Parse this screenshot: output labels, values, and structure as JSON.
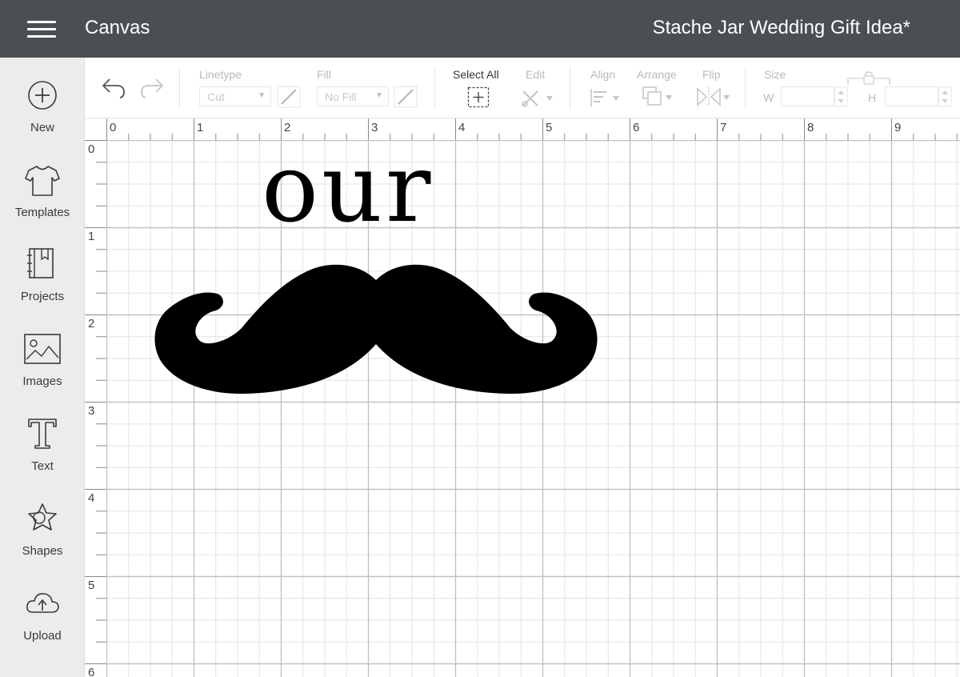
{
  "header": {
    "app_title": "Canvas",
    "project_title": "Stache Jar Wedding Gift Idea*"
  },
  "sidebar": {
    "items": [
      {
        "label": "New",
        "icon": "plus-circle-icon"
      },
      {
        "label": "Templates",
        "icon": "tshirt-icon"
      },
      {
        "label": "Projects",
        "icon": "notebook-icon"
      },
      {
        "label": "Images",
        "icon": "image-icon"
      },
      {
        "label": "Text",
        "icon": "text-t-icon"
      },
      {
        "label": "Shapes",
        "icon": "shapes-icon"
      },
      {
        "label": "Upload",
        "icon": "cloud-upload-icon"
      }
    ]
  },
  "toolbar": {
    "linetype_label": "Linetype",
    "linetype_value": "Cut",
    "fill_label": "Fill",
    "fill_value": "No Fill",
    "select_all_label": "Select All",
    "edit_label": "Edit",
    "align_label": "Align",
    "arrange_label": "Arrange",
    "flip_label": "Flip",
    "size_label": "Size",
    "width_label": "W",
    "height_label": "H"
  },
  "canvas": {
    "text_object": "our",
    "image_object": "mustache-image",
    "ruler_top": [
      "0",
      "1",
      "2",
      "3",
      "4",
      "5",
      "6",
      "7",
      "8",
      "9"
    ],
    "ruler_left": [
      "0",
      "1",
      "2",
      "3",
      "4",
      "5",
      "6"
    ]
  },
  "colors": {
    "header_bg": "#4a4f54",
    "sidebar_bg": "#ececec",
    "grid_major": "#c2c2c2",
    "grid_minor": "#e3e3e3",
    "object": "#000000"
  }
}
